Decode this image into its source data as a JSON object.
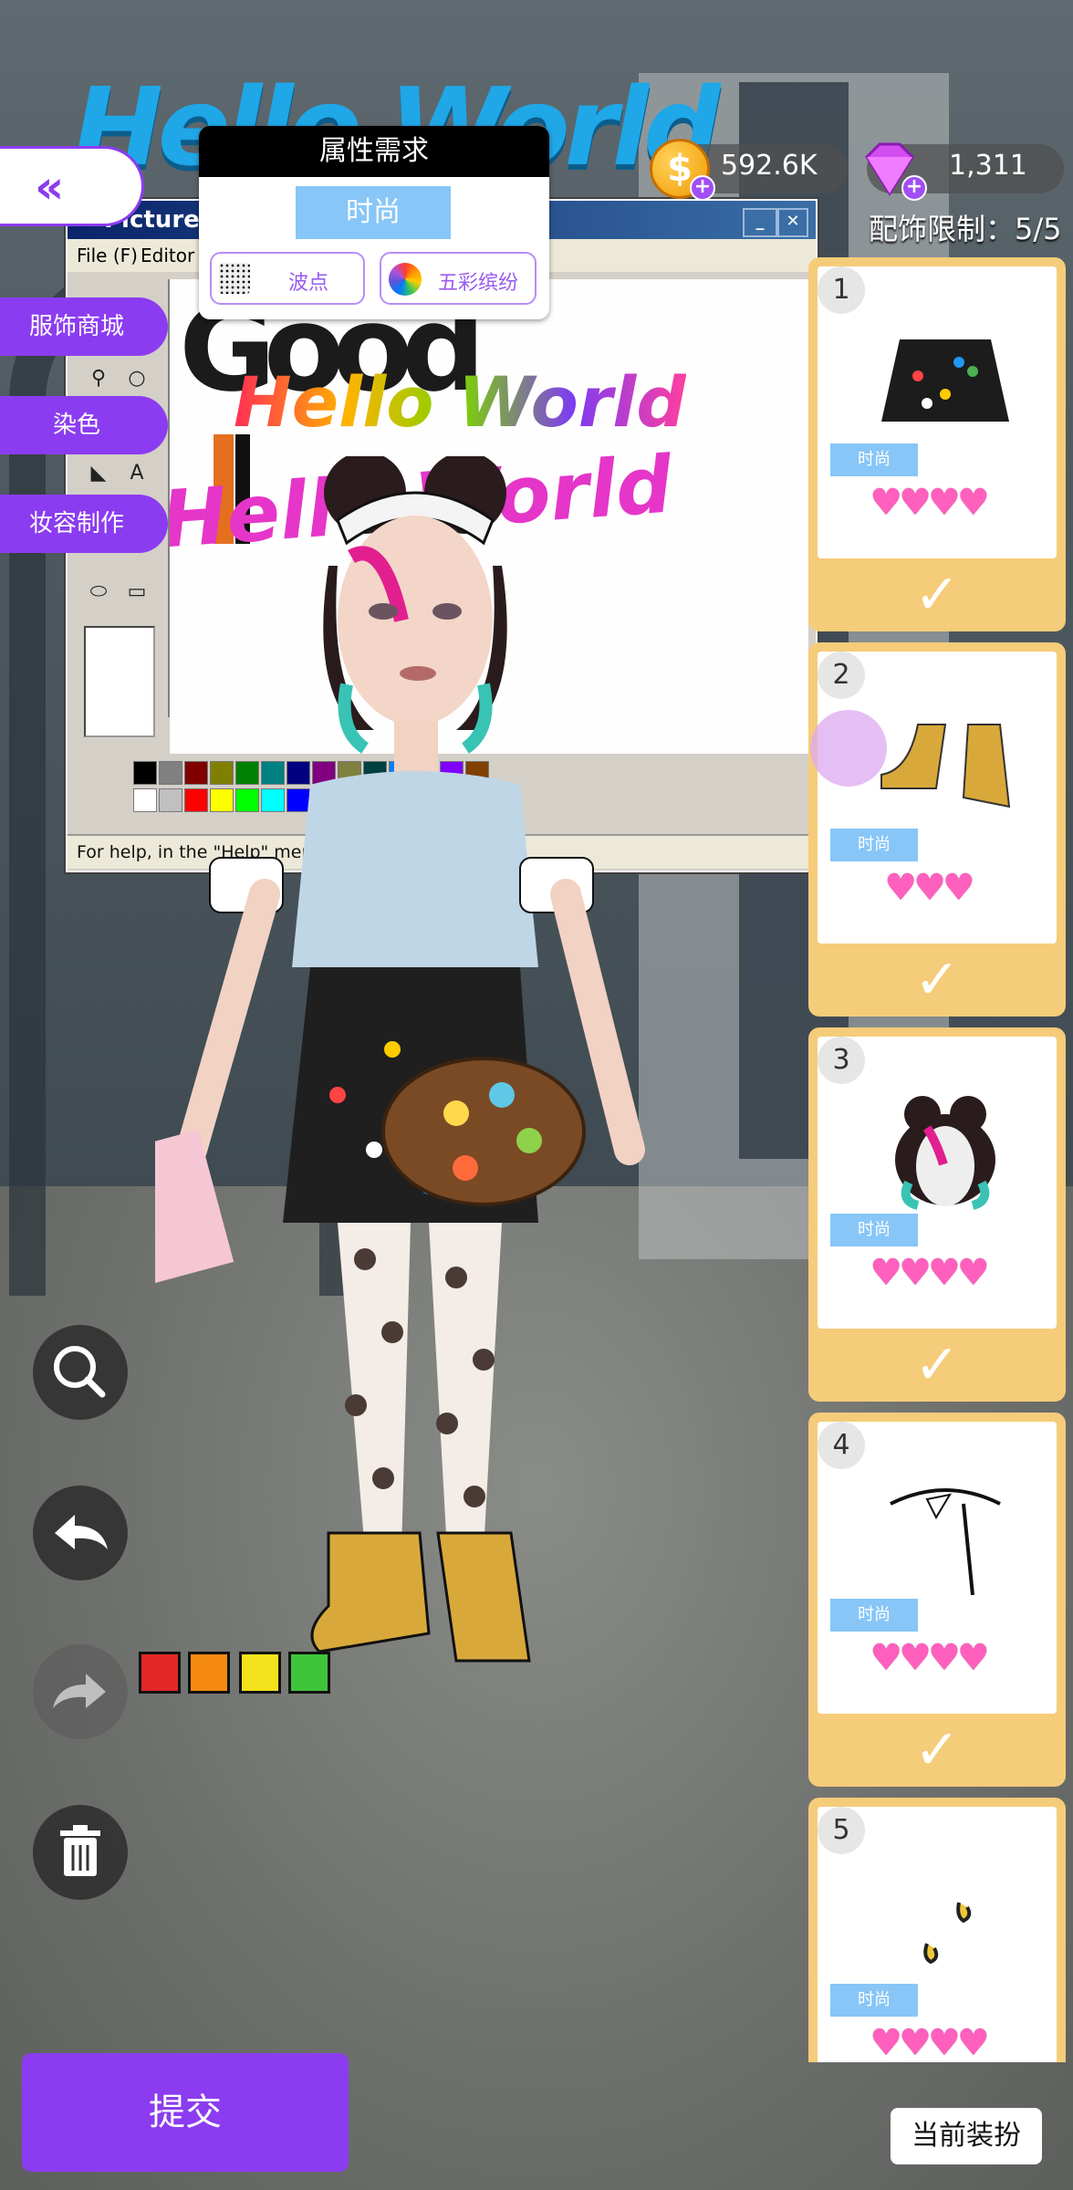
{
  "header": {
    "attribute_title": "属性需求",
    "style_tag": "时尚",
    "chips": [
      {
        "label": "波点",
        "icon": "polka-dot-icon"
      },
      {
        "label": "五彩缤纷",
        "icon": "rainbow-wheel-icon"
      }
    ],
    "coins": "592.6K",
    "gems": "1,311",
    "accessory_limit": "配饰限制：5/5"
  },
  "side_menu": {
    "shop": "服饰商城",
    "dye": "染色",
    "makeup": "妆容制作"
  },
  "scene": {
    "sign": "Hello World",
    "paint_title": "Picture",
    "paint_menu": [
      "File (F)",
      "Editor ("
    ],
    "canvas_text_1": "Hello World",
    "canvas_text_2": "Hello World",
    "canvas_text_3": "Good",
    "status_bar": "For help, in the \"Help\" menu, click \"Help Topics\"."
  },
  "items": [
    {
      "num": "1",
      "tag": "时尚",
      "hearts": 4,
      "selected": true,
      "icon": "skirt-icon"
    },
    {
      "num": "2",
      "tag": "时尚",
      "hearts": 3,
      "selected": true,
      "icon": "sneakers-icon"
    },
    {
      "num": "3",
      "tag": "时尚",
      "hearts": 4,
      "selected": true,
      "icon": "hair-icon"
    },
    {
      "num": "4",
      "tag": "时尚",
      "hearts": 4,
      "selected": true,
      "icon": "headband-icon"
    },
    {
      "num": "5",
      "tag": "时尚",
      "hearts": 4,
      "selected": false,
      "icon": "earrings-icon"
    }
  ],
  "footer": {
    "submit": "提交",
    "current_outfit": "当前装扮"
  },
  "colors": {
    "accent": "#8b3cf0",
    "tag_blue": "#87c6f7",
    "card_gold": "#f5cc79",
    "heart_pink": "#ff5fbd"
  }
}
